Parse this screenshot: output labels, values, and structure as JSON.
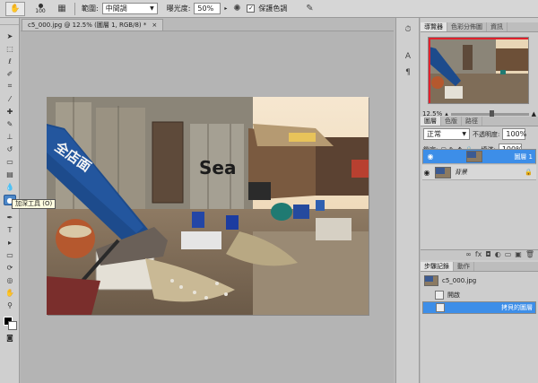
{
  "options_bar": {
    "brush_size": "100",
    "range_label": "範圍:",
    "range_value": "中間調",
    "exposure_label": "曝光度:",
    "exposure_value": "50%",
    "protect_tones_label": "保護色調"
  },
  "document": {
    "tab_title": "c5_000.jpg @ 12.5% (圖層 1, RGB/8) *",
    "close_glyph": "×",
    "photo_sign_text": "全店面",
    "photo_wall_text": "Sea"
  },
  "tooltip": {
    "text": "加深工具 (O)"
  },
  "navigator": {
    "tabs": [
      "導覽器",
      "色彩分佈圖",
      "資訊"
    ],
    "zoom": "12.5%"
  },
  "layers": {
    "tabs": [
      "圖層",
      "色版",
      "路徑"
    ],
    "blend_mode": "正常",
    "opacity_label": "不透明度:",
    "opacity_value": "100%",
    "lock_label": "鎖定:",
    "fill_label": "填滿:",
    "fill_value": "100%",
    "items": [
      {
        "name": "圖層 1",
        "selected": true
      },
      {
        "name": "背景",
        "selected": false
      }
    ]
  },
  "history": {
    "tabs": [
      "步驟記錄",
      "動作"
    ],
    "snapshot": "c5_000.jpg",
    "steps": [
      {
        "name": "開啟",
        "selected": false
      },
      {
        "name": "拷貝的圖層",
        "selected": true
      }
    ]
  },
  "colors": {
    "accent": "#3d8ee8",
    "nav_frame": "#e0212d",
    "foreground": "#000000",
    "background": "#ffffff"
  }
}
